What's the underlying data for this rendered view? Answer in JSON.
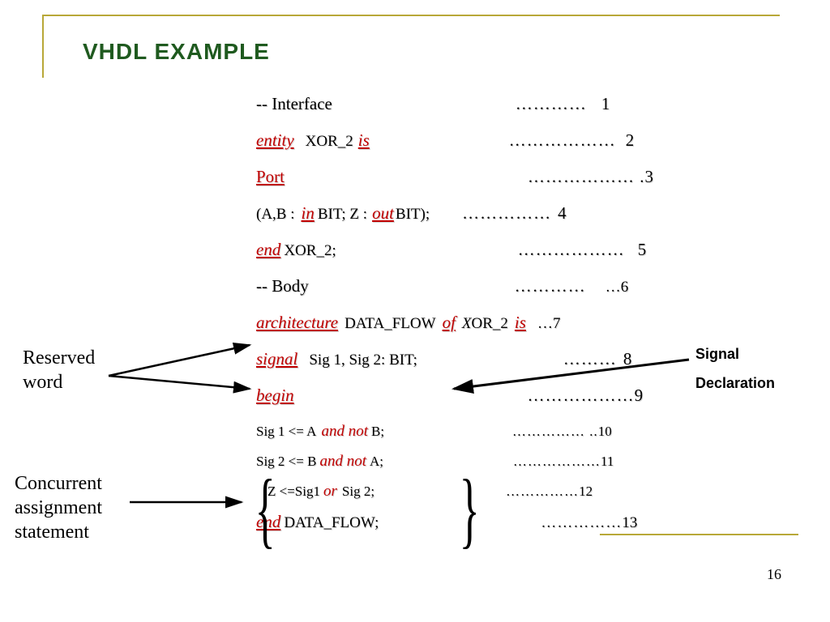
{
  "title": "VHDL EXAMPLE",
  "page_number": "16",
  "labels": {
    "reserved_word_l1": "Reserved",
    "reserved_word_l2": "word",
    "concurrent_l1": "Concurrent",
    "concurrent_l2": "assignment",
    "concurrent_l3": "statement",
    "signal_decl_l1": "Signal",
    "signal_decl_l2": "Declaration"
  },
  "code": {
    "l1_a": "-- Interface",
    "l1_b": "…………",
    "l1_n": "1",
    "l2_kw1": "entity",
    "l2_t1": "XOR_2",
    "l2_kw2": "is",
    "l2_b": "………………",
    "l2_n": "2",
    "l3_kw1": "Port",
    "l3_b": "……………… .",
    "l3_n": "3",
    "l4_t1": "(A,B :",
    "l4_kw1": "in",
    "l4_t2": "BIT;   Z :",
    "l4_kw2": "out",
    "l4_t3": "BIT);",
    "l4_b": "……………",
    "l4_n": "4",
    "l5_kw1": "end",
    "l5_t1": "XOR_2;",
    "l5_b": "………………",
    "l5_n": "5",
    "l6_a": "-- Body",
    "l6_b": "…………",
    "l6_n": "…6",
    "l7_kw1": "architecture",
    "l7_t1": "DATA_FLOW",
    "l7_kw2": "of",
    "l7_t2_a": "X",
    "l7_t2_b": "OR_2",
    "l7_kw3": "is",
    "l7_b": "…7",
    "l8_kw1": "signal",
    "l8_t1": "Sig 1, Sig 2: BIT;",
    "l8_b": "………",
    "l8_n": "8",
    "l9_kw1": "begin",
    "l9_b": "………………",
    "l9_n": "9",
    "l10_t1": "Sig 1 <= A",
    "l10_kw1": "and  not",
    "l10_t2": "B;",
    "l10_b": "…………… ..",
    "l10_n": "10",
    "l11_t1": "Sig 2 <= B",
    "l11_kw1": "and  not",
    "l11_t2": "A;",
    "l11_b": "………………",
    "l11_n": "11",
    "l12_t1": "Z    <=Sig1",
    "l12_kw1": "or",
    "l12_t2": "Sig 2;",
    "l12_b": "……………",
    "l12_n": "12",
    "l13_kw1": "end",
    "l13_t1": "DATA_FLOW;",
    "l13_b": "……………",
    "l13_n": "13"
  }
}
